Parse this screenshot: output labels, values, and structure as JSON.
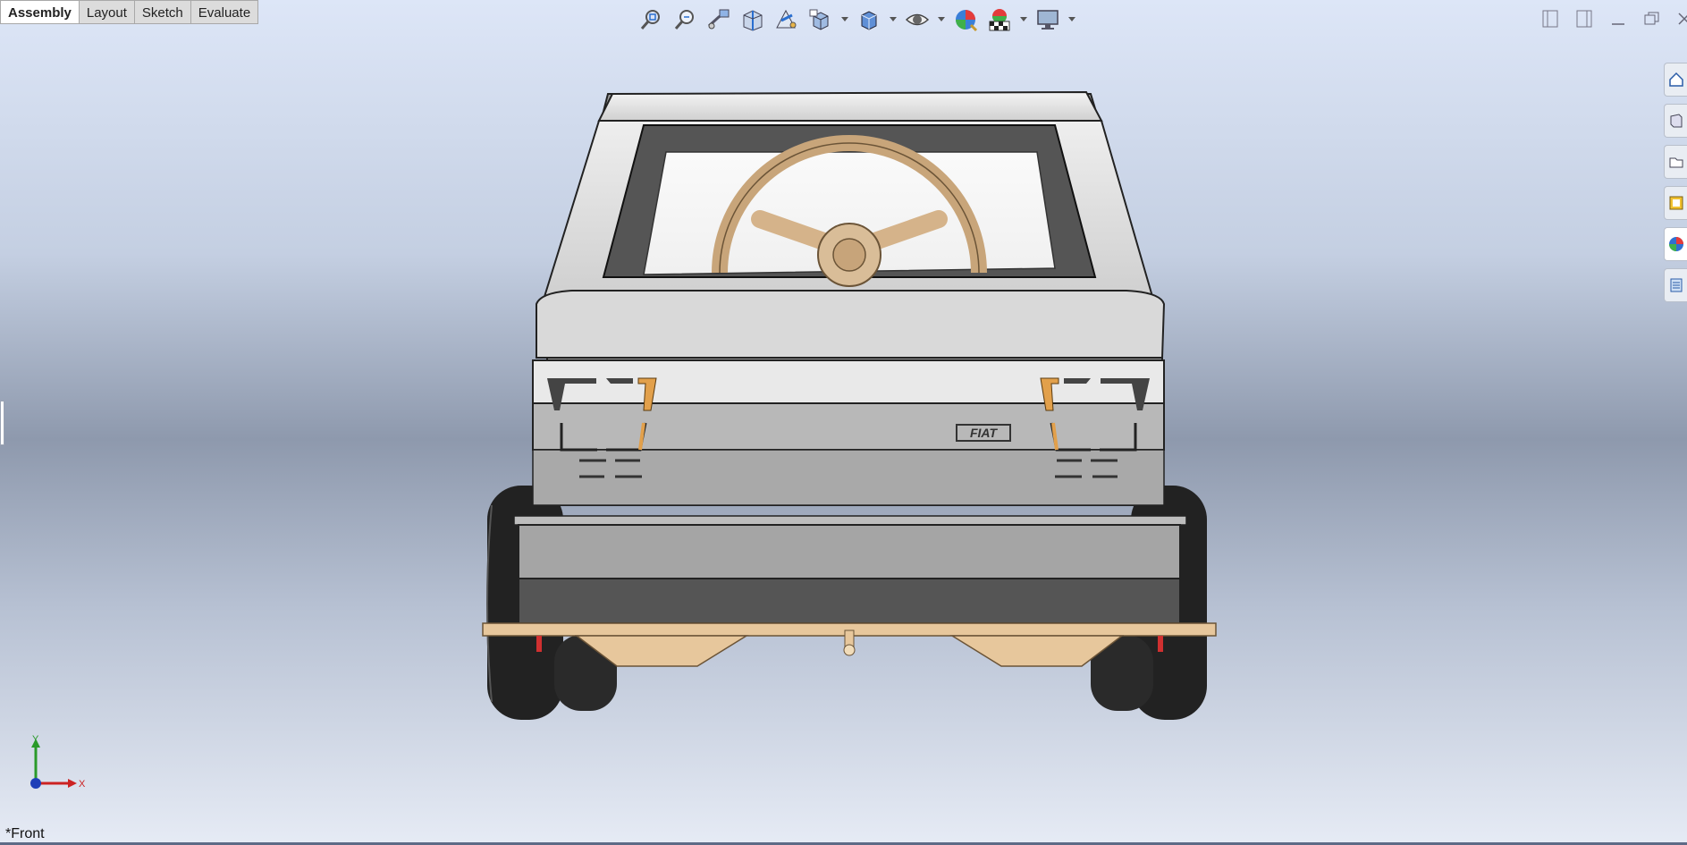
{
  "tabs": [
    "Assembly",
    "Layout",
    "Sketch",
    "Evaluate"
  ],
  "active_tab": "Assembly",
  "heads_up_toolbar": [
    {
      "name": "zoom-to-fit-icon"
    },
    {
      "name": "zoom-to-area-icon"
    },
    {
      "name": "previous-view-icon"
    },
    {
      "name": "section-view-icon"
    },
    {
      "name": "dynamic-annotation-views-icon"
    },
    {
      "name": "view-orientation-icon",
      "dropdown": true
    },
    {
      "name": "display-style-icon",
      "dropdown": true
    },
    {
      "name": "hide-show-items-icon",
      "dropdown": true
    },
    {
      "name": "edit-appearance-icon"
    },
    {
      "name": "apply-scene-icon",
      "dropdown": true
    },
    {
      "name": "view-settings-icon",
      "dropdown": true
    }
  ],
  "window_controls": [
    "tile-left-icon",
    "tile-right-icon",
    "minimize-icon",
    "restore-icon",
    "close-icon"
  ],
  "task_pane": [
    "solidworks-resources-icon",
    "design-library-icon",
    "file-explorer-icon",
    "view-palette-icon",
    "appearances-scenes-icon",
    "custom-properties-icon"
  ],
  "triad": {
    "y_label": "Y",
    "x_label": "X"
  },
  "view_name": "*Front",
  "model": {
    "badge_text": "FIAT"
  },
  "colors": {
    "accent": "#1f5fbf",
    "wood": "#e7c79c",
    "body": "#dcdcdc",
    "tire": "#1e1e1e"
  }
}
